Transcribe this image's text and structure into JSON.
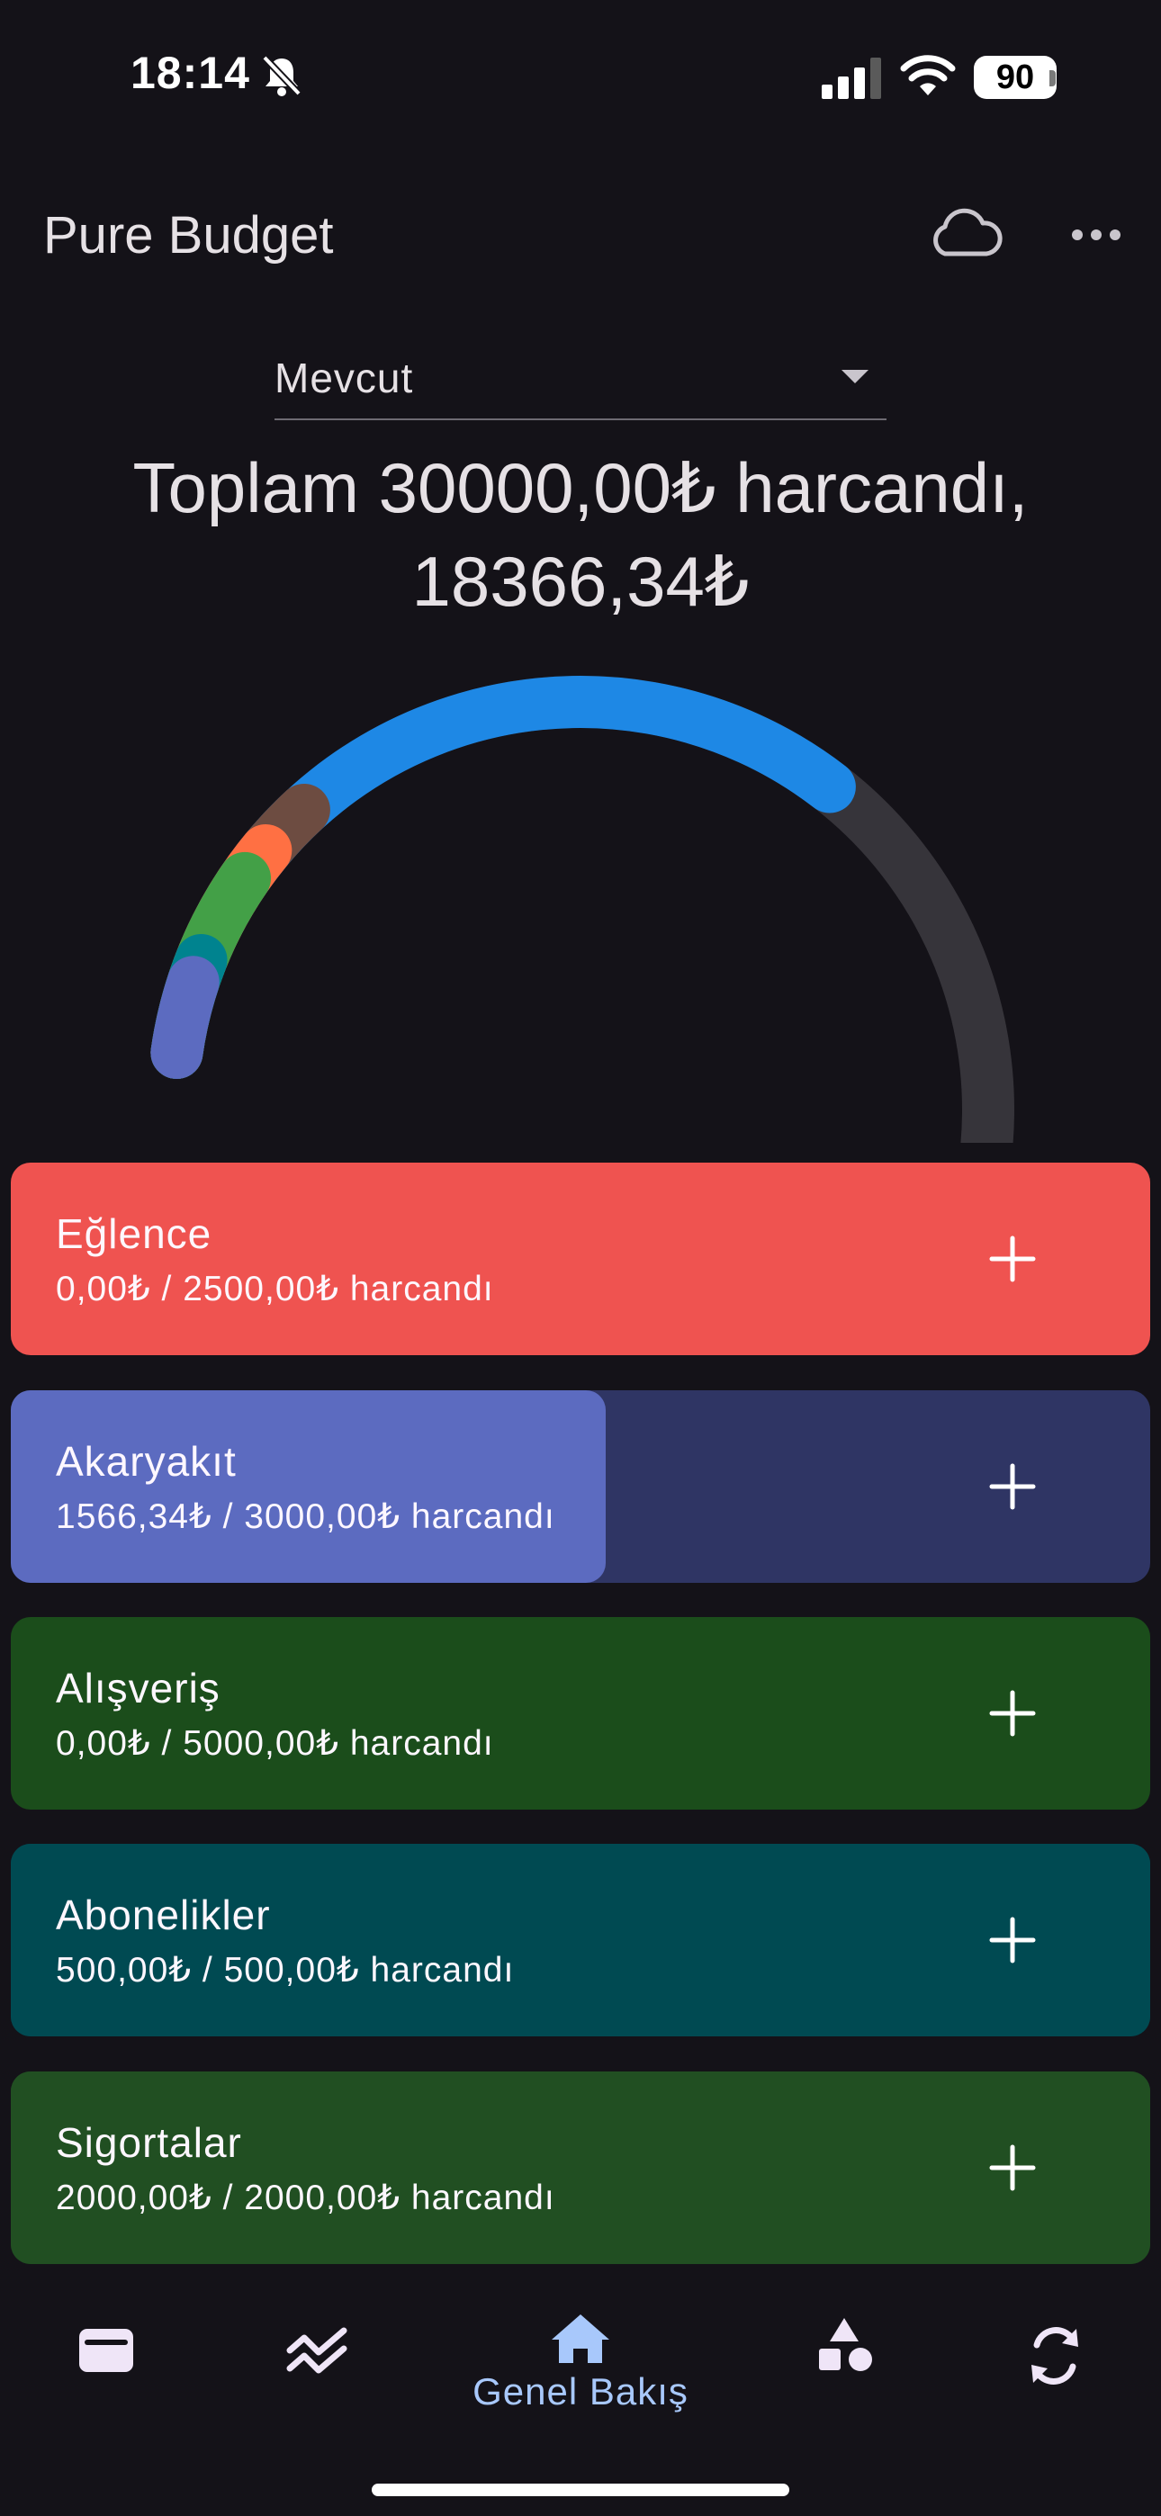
{
  "status_bar": {
    "time": "18:14",
    "battery": "90"
  },
  "app": {
    "title": "Pure Budget",
    "icons": [
      "cloud-icon",
      "more-icon"
    ]
  },
  "dropdown": {
    "value": "Mevcut"
  },
  "summary": {
    "line1": "Toplam 30000,00₺ harcandı,",
    "line2": "18366,34₺"
  },
  "gauge": {
    "track_color": "#36343a",
    "segments": [
      {
        "name": "Akaryakıt",
        "fraction": 0.0522,
        "color": "#5c6bc0"
      },
      {
        "name": "Abonelikler",
        "fraction": 0.0167,
        "color": "#00838f"
      },
      {
        "name": "Sigortalar",
        "fraction": 0.0667,
        "color": "#43a047"
      },
      {
        "name": "segment-orange",
        "fraction": 0.025,
        "color": "#ff7043"
      },
      {
        "name": "segment-brown",
        "fraction": 0.04,
        "color": "#6d4c41"
      },
      {
        "name": "segment-blue",
        "fraction": 0.41,
        "color": "#1e88e5"
      }
    ]
  },
  "budgets": [
    {
      "name": "Eğlence",
      "spent_text": "0,00₺ / 2500,00₺ harcandı",
      "progress": 0,
      "fill_color": "#5c6bc0",
      "bg_color": "#ef5350"
    },
    {
      "name": "Akaryakıt",
      "spent_text": "1566,34₺ / 3000,00₺ harcandı",
      "progress": 0.522,
      "fill_color": "#5c6bc0",
      "bg_color": "#2f3564"
    },
    {
      "name": "Alışveriş",
      "spent_text": "0,00₺ / 5000,00₺ harcandı",
      "progress": 0,
      "fill_color": "#1b4d1b",
      "bg_color": "#1b4d1b"
    },
    {
      "name": "Abonelikler",
      "spent_text": "500,00₺ / 500,00₺ harcandı",
      "progress": 1,
      "fill_color": "#004a52",
      "bg_color": "#004a52"
    },
    {
      "name": "Sigortalar",
      "spent_text": "2000,00₺ / 2000,00₺ harcandı",
      "progress": 1,
      "fill_color": "#214f22",
      "bg_color": "#214f22"
    }
  ],
  "nav": {
    "active_label": "Genel Bakış",
    "items": [
      "wallet-icon",
      "trend-icon",
      "home-icon",
      "categories-icon",
      "sync-icon"
    ]
  }
}
